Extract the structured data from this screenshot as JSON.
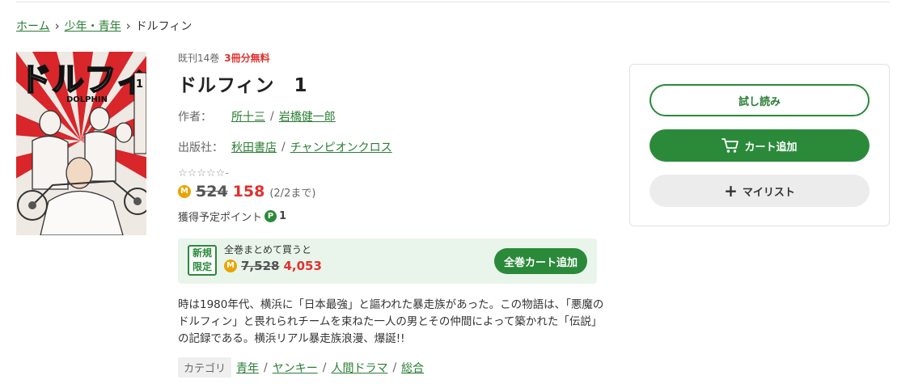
{
  "breadcrumb": {
    "home": "ホーム",
    "category": "少年・青年",
    "current": "ドルフィン"
  },
  "cover": {
    "title_art": "ドルフィン",
    "subtitle_art": "DOLPHIN",
    "volume_art": "1",
    "authors_art": "岩橋健一郎 所十三"
  },
  "book": {
    "volumes_published": "既刊14巻",
    "free_label": "3冊分無料",
    "title": "ドルフィン　1",
    "author_label": "作者：",
    "authors": [
      "所十三",
      "岩橋健一郎"
    ],
    "publisher_label": "出版社：",
    "publishers": [
      "秋田書店",
      "チャンピオンクロス"
    ],
    "rating_stars": "☆☆☆☆☆",
    "rating_value": "-",
    "coin_icon_text": "M",
    "original_price": "524",
    "sale_price": "158",
    "sale_until": "(2/2まで)",
    "points_label": "獲得予定ポイント",
    "points_icon_text": "P",
    "points_value": "1"
  },
  "bundle": {
    "badge_line1": "新規",
    "badge_line2": "限定",
    "lead": "全巻まとめて買うと",
    "original_price": "7,528",
    "sale_price": "4,053",
    "button_label": "全巻カート追加"
  },
  "description": "時は1980年代、横浜に「日本最強」と謳われた暴走族があった。この物語は、「悪魔のドルフィン」と畏れられチームを束ねた一人の男とその仲間によって築かれた「伝説」の記録である。横浜リアル暴走族浪漫、爆誕!!",
  "categories": {
    "label": "カテゴリ",
    "items": [
      "青年",
      "ヤンキー",
      "人間ドラマ",
      "総合"
    ]
  },
  "actions": {
    "trial_label": "試し読み",
    "cart_label": "カート追加",
    "mylist_label": "マイリスト"
  },
  "colors": {
    "accent_green": "#2a8a3a",
    "link_green": "#2a7d34",
    "sale_red": "#e0312f",
    "coin_gold": "#e8a400",
    "bundle_bg": "#e9f5ea"
  },
  "icons": {
    "cart": "cart-icon",
    "plus": "plus-icon",
    "chevron": "chevron-right-icon"
  }
}
